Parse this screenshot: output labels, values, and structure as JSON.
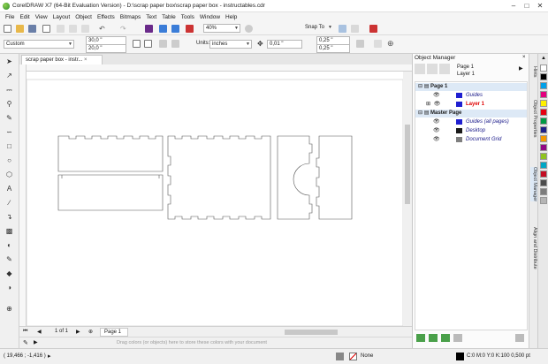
{
  "window": {
    "title": "CorelDRAW X7 (64-Bit Evaluation Version) - D:\\scrap paper box\\scrap paper box - instructables.cdr"
  },
  "menu": [
    "File",
    "Edit",
    "View",
    "Layout",
    "Object",
    "Effects",
    "Bitmaps",
    "Text",
    "Table",
    "Tools",
    "Window",
    "Help"
  ],
  "toolbar": {
    "zoom": "40%",
    "snap_to": "Snap To"
  },
  "property_bar": {
    "preset": "Custom",
    "page_width": "30,0 \"",
    "page_height": "20,0 \"",
    "units_label": "Units:",
    "units": "inches",
    "nudge": "0,01 \"",
    "dup_x": "0,25 \"",
    "dup_y": "0,25 \""
  },
  "document_tab": "scrap paper box - instr...",
  "navigator": {
    "page_count": "1 of 1",
    "page_tab": "Page 1"
  },
  "color_hint": "Drag colors (or objects) here to store these colors with your document",
  "status": {
    "coords": "( 19,466 ; -1,416 )",
    "fill": "None",
    "outline": "C:0 M:0 Y:0 K:100  0,500 pt"
  },
  "object_manager": {
    "title": "Object Manager",
    "current_page": "Page 1",
    "current_layer": "Layer 1",
    "tree": [
      {
        "label": "Page 1",
        "kind": "page"
      },
      {
        "label": "Guides",
        "kind": "layer",
        "color": "#1f1fd0"
      },
      {
        "label": "Layer 1",
        "kind": "active-layer",
        "color": "#ff0000"
      },
      {
        "label": "Master Page",
        "kind": "page"
      },
      {
        "label": "Guides (all pages)",
        "kind": "master-layer",
        "color": "#1f1fd0"
      },
      {
        "label": "Desktop",
        "kind": "master-layer",
        "color": "#1a1a1a"
      },
      {
        "label": "Document Grid",
        "kind": "master-layer",
        "color": "#7f7f7f"
      }
    ]
  },
  "side_tabs": [
    "Hints",
    "Object Properties",
    "Object Manager",
    "Align and Distribute"
  ],
  "palette_colors": [
    "#ffffff",
    "#000000",
    "#00a0e9",
    "#e4007f",
    "#fff100",
    "#e60012",
    "#009944",
    "#1d2088",
    "#f39800",
    "#920783",
    "#8fc31f",
    "#00a7c5",
    "#c30d23",
    "#4c4c4c",
    "#7d7d7d",
    "#b5b5b5"
  ],
  "colors": {
    "ui_bg": "#f0f0f0",
    "canvas": "#ffffff",
    "outline": "#555555",
    "selection": "#cfe3f7"
  }
}
